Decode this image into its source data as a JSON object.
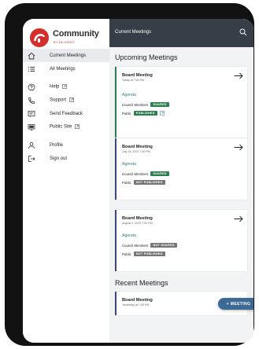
{
  "brand": {
    "name": "Community",
    "sub": "BY DILIGENT"
  },
  "nav": [
    {
      "label": "Current Meetings",
      "icon": "home-icon",
      "active": true
    },
    {
      "label": "All Meetings",
      "icon": "list-icon"
    },
    {
      "label": "Help",
      "icon": "help-icon",
      "external": true
    },
    {
      "label": "Support",
      "icon": "phone-icon",
      "external": true
    },
    {
      "label": "Send Feedback",
      "icon": "feedback-icon"
    },
    {
      "label": "Public Site",
      "icon": "monitor-icon",
      "external": true
    },
    {
      "label": "Profile",
      "icon": "person-icon"
    },
    {
      "label": "Sign out",
      "icon": "sign-out-icon"
    }
  ],
  "topbar": {
    "title": "Current Meetings",
    "search_icon": "search-icon"
  },
  "upcoming": {
    "heading": "Upcoming Meetings",
    "meetings": [
      {
        "title": "Board Meeting",
        "date": "Today at 7:00 PM",
        "agenda": "Agenda",
        "council_label": "Council Members",
        "council_status": "SHARED",
        "public_label": "Public",
        "public_status": "PUBLISHED"
      },
      {
        "title": "Board Meeting",
        "date": "July 24, 2023 7:00 PM",
        "agenda": "Agenda",
        "council_label": "Council Members",
        "council_status": "SHARED",
        "public_label": "Public",
        "public_status": "NOT PUBLISHED"
      },
      {
        "title": "Board Meeting",
        "date": "August 4, 2023 7:00 PM",
        "agenda": "Agenda",
        "council_label": "Council Members",
        "council_status": "NOT SHARED",
        "public_label": "Public",
        "public_status": "NOT PUBLISHED"
      }
    ]
  },
  "recent": {
    "heading": "Recent Meetings",
    "meetings": [
      {
        "title": "Board Meeting",
        "date": "Yesterday at 7:00 PM"
      }
    ]
  },
  "fab": {
    "label": "+ MEETING"
  },
  "colors": {
    "topbar": "#373e48",
    "accent_green": "#2e7d4f",
    "accent_navy": "#3a4a7a",
    "link": "#2f7d86",
    "fab": "#3d6a95"
  }
}
